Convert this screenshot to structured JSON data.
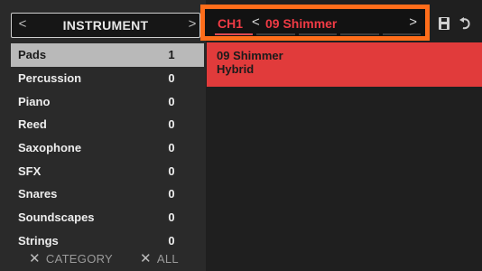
{
  "left_header": {
    "prev": "<",
    "title": "INSTRUMENT",
    "next": ">"
  },
  "categories": [
    {
      "label": "Pads",
      "count": "1"
    },
    {
      "label": "Percussion",
      "count": "0"
    },
    {
      "label": "Piano",
      "count": "0"
    },
    {
      "label": "Reed",
      "count": "0"
    },
    {
      "label": "Saxophone",
      "count": "0"
    },
    {
      "label": "SFX",
      "count": "0"
    },
    {
      "label": "Snares",
      "count": "0"
    },
    {
      "label": "Soundscapes",
      "count": "0"
    },
    {
      "label": "Strings",
      "count": "0"
    }
  ],
  "footer": {
    "category_x": "✕",
    "category_label": "CATEGORY",
    "all_x": "✕",
    "all_label": "ALL"
  },
  "preset_bar": {
    "channel": "CH1",
    "prev": "<",
    "name": "09 Shimmer",
    "next": ">"
  },
  "result": {
    "name": "09 Shimmer",
    "subtitle": "Hybrid"
  },
  "colors": {
    "accent": "#e13b3b",
    "highlight": "#ff6d1a",
    "selected_row": "#b9b9b9"
  },
  "icons": {
    "save": "save-icon",
    "undo": "undo-icon"
  }
}
